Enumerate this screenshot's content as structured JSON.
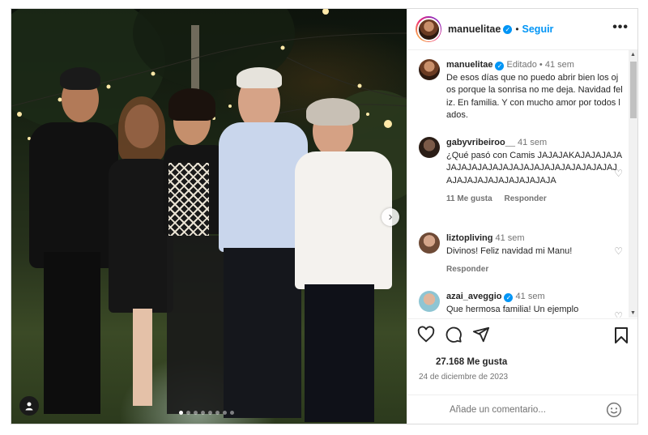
{
  "post": {
    "author": "manuelitae",
    "follow_label": "Seguir",
    "more_label": "•••",
    "caption_meta_edit": "Editado",
    "caption_meta_sep": "•",
    "caption_time": "41 sem",
    "caption_text": "De esos días que no puedo abrir bien los ojos porque la sonrisa no me deja. Navidad feliz. En familia. Y con mucho amor por todos lados.",
    "carousel_count": 8,
    "carousel_active": 0
  },
  "comments": [
    {
      "user": "gabyvribeiroo__",
      "time": "41 sem",
      "text": "¿Qué pasó con Camis JAJAJAKAJAJAJAJAJAJAJAJAJAJAJAJAJAJAJAJAJAJAJAJAJAJAJAJAJAJAJAJAJAJAJA",
      "likes": "11 Me gusta",
      "reply": "Responder"
    },
    {
      "user": "liztopliving",
      "time": "41 sem",
      "text": "Divinos! Feliz navidad mi Manu!",
      "reply": "Responder"
    },
    {
      "user": "azai_aveggio",
      "time": "41 sem",
      "text": "Que hermosa familia! Un ejemplo"
    }
  ],
  "actions": {
    "likes": "27.168 Me gusta",
    "date": "24 de diciembre de 2023",
    "comment_placeholder": "Añade un comentario..."
  },
  "icons": {
    "more": "more-icon",
    "verified": "verified-icon",
    "heart": "heart-icon",
    "comment": "comment-icon",
    "share": "share-icon",
    "bookmark": "bookmark-icon",
    "emoji": "emoji-icon",
    "tag": "user-tag-icon",
    "next": "chevron-right-icon"
  },
  "colors": {
    "accent": "#0095f6",
    "text": "#262626",
    "muted": "#737373"
  }
}
